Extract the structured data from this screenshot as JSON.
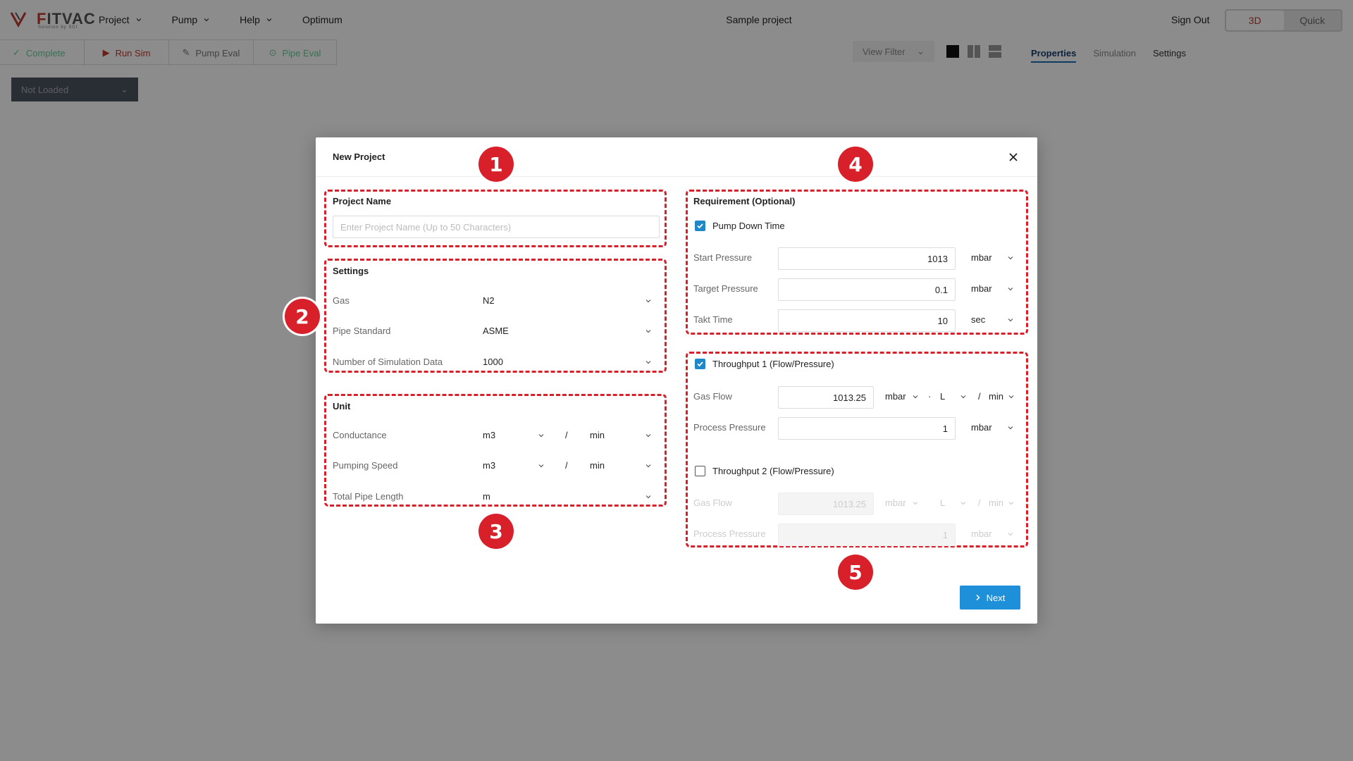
{
  "app": {
    "logo_text_a": "F",
    "logo_text_b": "ITVAC",
    "logo_sub": "Solution by SCI",
    "menu": [
      {
        "label": "Project"
      },
      {
        "label": "Pump"
      },
      {
        "label": "Help"
      },
      {
        "label": "Optimum"
      }
    ],
    "project_title": "Sample project",
    "sign_out": "Sign Out",
    "view_toggle": {
      "a": "3D",
      "b": "Quick"
    },
    "toolbar": {
      "complete": "Complete",
      "run_sim": "Run Sim",
      "pump_eval": "Pump Eval",
      "pipe_eval": "Pipe Eval"
    },
    "view_filter": "View Filter",
    "right_tabs": {
      "properties": "Properties",
      "simulation": "Simulation",
      "settings": "Settings"
    },
    "not_loaded": "Not Loaded"
  },
  "modal": {
    "title": "New Project",
    "project_name": {
      "title": "Project Name",
      "placeholder": "Enter Project Name (Up to 50 Characters)"
    },
    "settings": {
      "title": "Settings",
      "gas_label": "Gas",
      "gas_value": "N2",
      "pipe_label": "Pipe Standard",
      "pipe_value": "ASME",
      "sim_label": "Number of Simulation Data",
      "sim_value": "1000"
    },
    "unit": {
      "title": "Unit",
      "conductance_label": "Conductance",
      "conductance_a": "m3",
      "conductance_b": "min",
      "pumping_label": "Pumping Speed",
      "pumping_a": "m3",
      "pumping_b": "min",
      "length_label": "Total Pipe Length",
      "length_a": "m",
      "slash": "/"
    },
    "requirement": {
      "title": "Requirement (Optional)",
      "pump_down_label": "Pump Down Time",
      "start_label": "Start Pressure",
      "start_value": "1013",
      "start_unit": "mbar",
      "target_label": "Target Pressure",
      "target_value": "0.1",
      "target_unit": "mbar",
      "takt_label": "Takt Time",
      "takt_value": "10",
      "takt_unit": "sec"
    },
    "throughput1": {
      "label": "Throughput 1 (Flow/Pressure)",
      "gas_label": "Gas Flow",
      "gas_value": "1013.25",
      "u1": "mbar",
      "dot": "·",
      "u2": "L",
      "slash": "/",
      "u3": "min",
      "proc_label": "Process Pressure",
      "proc_value": "1",
      "proc_unit": "mbar"
    },
    "throughput2": {
      "label": "Throughput 2 (Flow/Pressure)",
      "gas_label": "Gas Flow",
      "gas_value": "1013.25",
      "u1": "mbar",
      "u2": "L",
      "slash": "/",
      "u3": "min",
      "proc_label": "Process Pressure",
      "proc_value": "1",
      "proc_unit": "mbar"
    },
    "badges": [
      "1",
      "2",
      "3",
      "4",
      "5"
    ],
    "next": "Next"
  },
  "colors": {
    "annotation_red": "#d8202a",
    "primary_blue": "#1e8fd9",
    "checkbox_blue": "#1e88c8"
  }
}
